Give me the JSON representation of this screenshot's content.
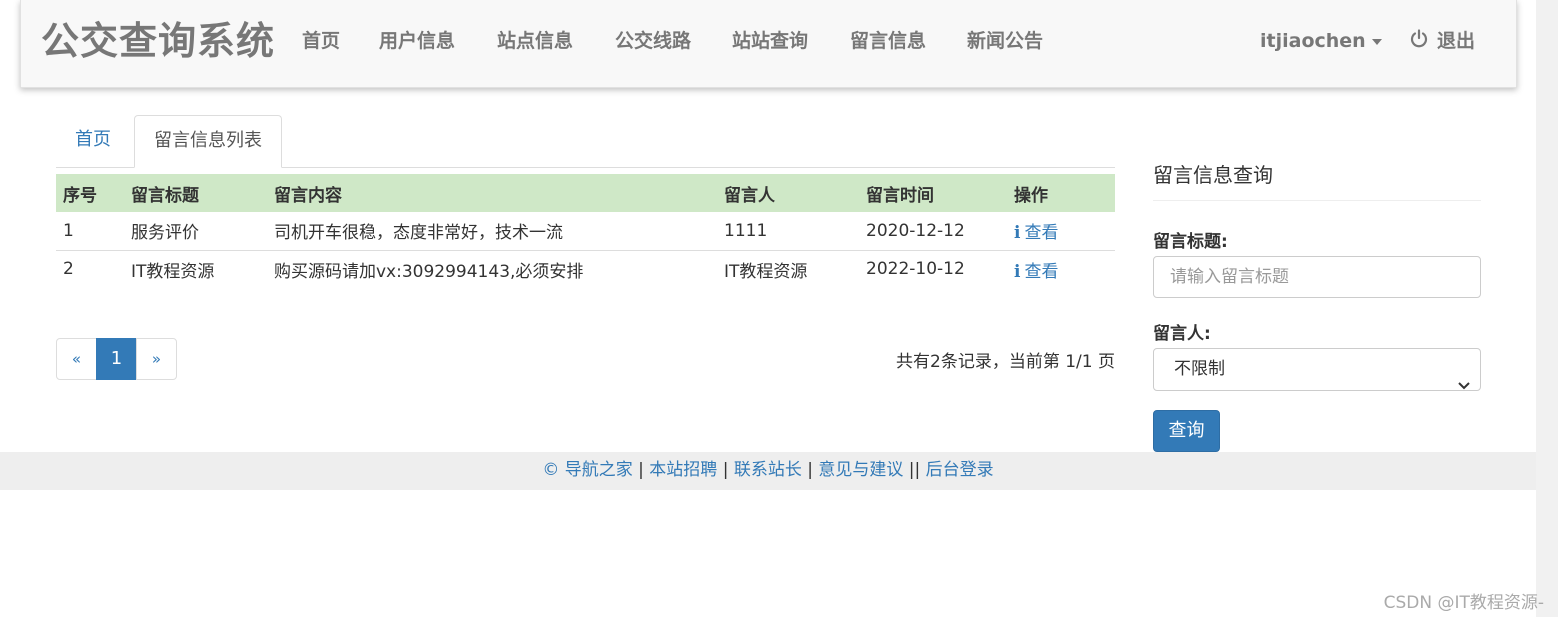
{
  "navbar": {
    "brand": "公交查询系统",
    "items": [
      {
        "label": "首页"
      },
      {
        "label": "用户信息"
      },
      {
        "label": "站点信息"
      },
      {
        "label": "公交线路"
      },
      {
        "label": "站站查询"
      },
      {
        "label": "留言信息"
      },
      {
        "label": "新闻公告"
      }
    ],
    "user": "itjiaochen",
    "logout": "退出"
  },
  "tabs": {
    "home": "首页",
    "active": "留言信息列表"
  },
  "table": {
    "headers": [
      "序号",
      "留言标题",
      "留言内容",
      "留言人",
      "留言时间",
      "操作"
    ],
    "rows": [
      {
        "no": "1",
        "title": "服务评价",
        "content": "司机开车很稳，态度非常好，技术一流",
        "author": "1111",
        "time": "2020-12-12",
        "action": "查看"
      },
      {
        "no": "2",
        "title": "IT教程资源",
        "content": "购买源码请加vx:3092994143,必须安排",
        "author": "IT教程资源",
        "time": "2022-10-12",
        "action": "查看"
      }
    ]
  },
  "pagination": {
    "prev": "«",
    "current": "1",
    "next": "»",
    "info": "共有2条记录，当前第 1/1 页"
  },
  "search_panel": {
    "title": "留言信息查询",
    "title_label": "留言标题:",
    "title_placeholder": "请输入留言标题",
    "author_label": "留言人:",
    "author_selected": "不限制",
    "submit": "查询"
  },
  "footer": {
    "links": [
      "© 导航之家",
      "本站招聘",
      "联系站长",
      "意见与建议",
      "后台登录"
    ],
    "separator": "|"
  },
  "watermark": "CSDN @IT教程资源-",
  "colors": {
    "primary": "#337ab7",
    "table_header_bg": "#cfe8c7",
    "navbar_bg": "#f8f8f8",
    "footer_bg": "#eeeeee"
  }
}
